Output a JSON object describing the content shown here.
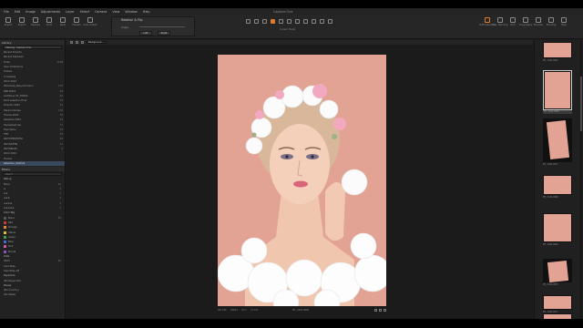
{
  "menubar": {
    "items": [
      "File",
      "Edit",
      "Image",
      "Adjustments",
      "Layer",
      "Select",
      "Camera",
      "View",
      "Window",
      "Help"
    ],
    "center_title": "Capture One"
  },
  "toolbar": {
    "left_buttons": [
      "Import",
      "Export",
      "Capture",
      "Undo",
      "Redo",
      "Presets",
      "Auto Adjust"
    ],
    "tool_panel": {
      "title": "Rotation & Flip",
      "angle_label": "Angle",
      "left": "Left",
      "right": "Right"
    },
    "cursor_label": "Cursor Tools",
    "right_buttons": [
      "Edit Selected",
      "Exp. Warning",
      "Grid",
      "Copy/Apply",
      "Preview",
      "Proofing",
      "Help"
    ]
  },
  "library": {
    "header": "Library",
    "selector": "Catalog: Capture One",
    "items": [
      {
        "label": "Recent Imports",
        "count": ""
      },
      {
        "label": "Recent Captures",
        "count": ""
      },
      {
        "label": "Trash",
        "count": "1168"
      },
      {
        "label": "User Collections",
        "count": ""
      },
      {
        "label": "Folders",
        "count": ""
      },
      {
        "label": "In Catalog",
        "count": ""
      },
      {
        "label": "Work 2024",
        "count": ""
      },
      {
        "label": "Workshop_Neuyorkmann",
        "count": "135"
      },
      {
        "label": "PRE-SHOT",
        "count": "48"
      },
      {
        "label": "Auditions 32_TODKA",
        "count": "64"
      },
      {
        "label": "Print selection Final",
        "count": "23"
      },
      {
        "label": "Director 2023",
        "count": "42"
      },
      {
        "label": "Harem Damas",
        "count": "102"
      },
      {
        "label": "Theme 2023",
        "count": "38"
      },
      {
        "label": "Sabadira 2023",
        "count": "24"
      },
      {
        "label": "Производство",
        "count": "71"
      },
      {
        "label": "Портреты",
        "count": "15"
      },
      {
        "label": "ТЕБ",
        "count": "83"
      },
      {
        "label": "ФОТОПРОЕКТЫ",
        "count": "49"
      },
      {
        "label": "ФОТОСЕТЫ",
        "count": "27"
      },
      {
        "label": "ФОТОБАЗА",
        "count": "2"
      },
      {
        "label": "Work 2019",
        "count": ""
      },
      {
        "label": "Theme",
        "count": ""
      },
      {
        "label": "Selection_Studio4",
        "count": "",
        "selected": true
      }
    ]
  },
  "filters": {
    "header": "Filters",
    "search_placeholder": "Search",
    "rating_label": "Rating",
    "ratings": [
      {
        "label": "None",
        "count": "41"
      },
      {
        "label": "★",
        "count": "2"
      },
      {
        "label": "★★",
        "count": "1"
      },
      {
        "label": "★★★",
        "count": "1"
      },
      {
        "label": "★★★★",
        "count": "1"
      },
      {
        "label": "★★★★★",
        "count": "1"
      }
    ],
    "color_tag_label": "Color Tag",
    "colors": [
      {
        "label": "None",
        "color": "#555555",
        "count": "63"
      },
      {
        "label": "Red",
        "color": "#d23a32",
        "count": ""
      },
      {
        "label": "Orange",
        "color": "#e58a2c",
        "count": ""
      },
      {
        "label": "Yellow",
        "color": "#d8c23a",
        "count": ""
      },
      {
        "label": "Green",
        "color": "#3fa34a",
        "count": ""
      },
      {
        "label": "Blue",
        "color": "#3b6fd1",
        "count": ""
      },
      {
        "label": "Pink",
        "color": "#d05aa6",
        "count": ""
      },
      {
        "label": "Purple",
        "color": "#8a53c4",
        "count": ""
      }
    ],
    "date_label": "Date",
    "dates": [
      {
        "label": "2023",
        "count": "63"
      },
      {
        "label": "Сентябрь",
        "count": ""
      },
      {
        "label": "Сентябрь 18",
        "count": ""
      }
    ],
    "keywords_label": "Keywords",
    "keywords": [
      {
        "label": "(No Keywords)",
        "count": ""
      }
    ],
    "places_label": "Places",
    "places": [
      {
        "label": "(No Country)",
        "count": ""
      },
      {
        "label": "(No State)",
        "count": ""
      }
    ]
  },
  "viewer": {
    "toolbar_select": "Background",
    "footer": {
      "iso": "ISO 100",
      "shutter": "1/160 s",
      "aperture": "f/7.1",
      "focal": "77 mm",
      "filename": "PH_ 2024.0965"
    }
  },
  "filmstrip": {
    "thumbs": [
      {
        "caption": "PH_ 2024.0965"
      },
      {
        "caption": "PH_ 2024.0966"
      },
      {
        "caption": "PH_ 2024.0967"
      },
      {
        "caption": "PH_ 2024.0968"
      },
      {
        "caption": "PH_ 2024.0969"
      },
      {
        "caption": "PH_ 2024.0970"
      },
      {
        "caption": "PH_ 2024.0971"
      },
      {
        "caption": "PH_ 2024.0972"
      }
    ]
  },
  "colors": {
    "accent": "#e07b2c",
    "backdrop": "#e3a394",
    "panel": "#222222"
  }
}
